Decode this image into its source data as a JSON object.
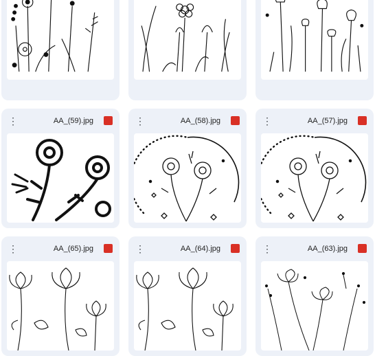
{
  "accent": {
    "file_type_icon": "#d93025",
    "card_bg": "#edf1f8"
  },
  "icons": {
    "menu": "vertical-dots-icon",
    "file_type": "image-file-icon"
  },
  "files": [
    {
      "name": "",
      "thumbnail": "wildflowers-line-art"
    },
    {
      "name": "",
      "thumbnail": "wildflowers-tall-line-art"
    },
    {
      "name": "",
      "thumbnail": "tulips-line-art"
    },
    {
      "name": "AA_(59).jpg",
      "thumbnail": "bold-blossoms"
    },
    {
      "name": "AA_(58).jpg",
      "thumbnail": "flowers-in-dotted-circle"
    },
    {
      "name": "AA_(57).jpg",
      "thumbnail": "flowers-in-dotted-circle"
    },
    {
      "name": "AA_(65).jpg",
      "thumbnail": "detailed-flowers-line-art"
    },
    {
      "name": "AA_(64).jpg",
      "thumbnail": "detailed-flowers-line-art"
    },
    {
      "name": "AA_(63).jpg",
      "thumbnail": "delicate-wildflowers"
    }
  ]
}
